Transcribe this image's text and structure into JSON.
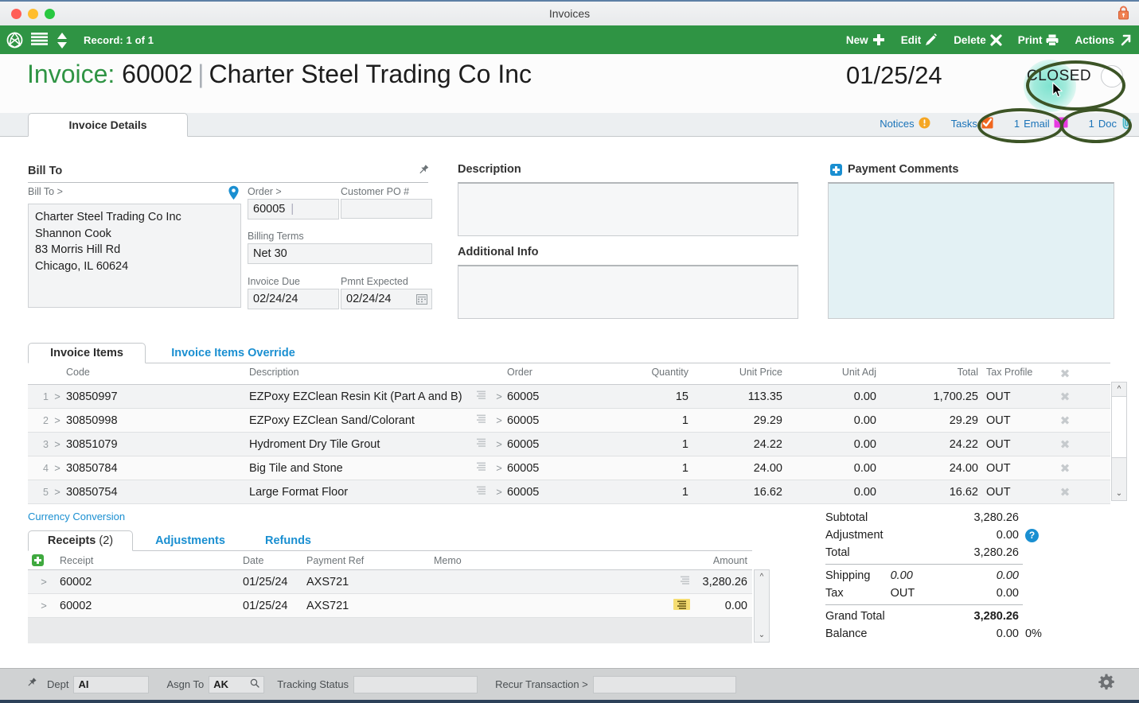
{
  "window": {
    "title": "Invoices",
    "lock_icon": "lock-icon"
  },
  "toolbar": {
    "record_label": "Record: 1 of 1",
    "globe_icon": "globe-icon",
    "list_icon": "list-icon",
    "updown_icon": "up-down-arrows-icon",
    "actions": [
      {
        "label": "New",
        "icon": "plus-icon"
      },
      {
        "label": "Edit",
        "icon": "pencil-icon"
      },
      {
        "label": "Delete",
        "icon": "x-cross-icon"
      },
      {
        "label": "Print",
        "icon": "printer-icon"
      },
      {
        "label": "Actions",
        "icon": "arrow-up-right-icon"
      }
    ]
  },
  "header": {
    "entity_word": "Invoice:",
    "separator": "|",
    "record_number": "60002",
    "customer_name": "Charter Steel Trading Co Inc",
    "date": "01/25/24",
    "status": "CLOSED"
  },
  "tabs": {
    "main": "Invoice Details"
  },
  "header_links": [
    {
      "label": "Notices",
      "icon": "warning-icon"
    },
    {
      "label": "Tasks",
      "icon": "checkbox-checked-icon"
    },
    {
      "count": "1",
      "label": "Email",
      "icon": "envelope-icon"
    },
    {
      "count": "1",
      "label": "Doc",
      "icon": "paperclip-icon"
    }
  ],
  "billto": {
    "title": "Bill To",
    "pin_icon": "pushpin-icon",
    "field_label": "Bill To >",
    "location_icon": "map-pin-icon",
    "address_lines": "Charter Steel Trading Co Inc\nShannon Cook\n83 Morris Hill Rd\nChicago, IL 60624",
    "order_label": "Order >",
    "order_value": "60005",
    "customer_po_label": "Customer PO #",
    "customer_po_value": "",
    "billing_terms_label": "Billing Terms",
    "billing_terms_value": "Net 30",
    "invoice_due_label": "Invoice Due",
    "invoice_due_value": "02/24/24",
    "pmnt_expected_label": "Pmnt Expected",
    "pmnt_expected_value": "02/24/24",
    "calendar_icon": "calendar-icon"
  },
  "description": {
    "title": "Description",
    "value": ""
  },
  "additional_info": {
    "title": "Additional Info",
    "value": ""
  },
  "payment_comments": {
    "title": "Payment Comments",
    "value": "",
    "add_icon": "plus-square-icon"
  },
  "items": {
    "tabs": [
      {
        "label": "Invoice Items",
        "active": true
      },
      {
        "label": "Invoice Items Override",
        "active": false
      }
    ],
    "columns": [
      "Code",
      "Description",
      "Order",
      "Quantity",
      "Unit Price",
      "Unit Adj",
      "Total",
      "Tax Profile"
    ],
    "rows": [
      {
        "idx": "1",
        "code": "30850997",
        "description": "EZPoxy EZClean Resin Kit (Part A and B)",
        "order": "60005",
        "quantity": "15",
        "unit_price": "113.35",
        "unit_adj": "0.00",
        "total": "1,700.25",
        "tax_profile": "OUT"
      },
      {
        "idx": "2",
        "code": "30850998",
        "description": "EZPoxy EZClean Sand/Colorant",
        "order": "60005",
        "quantity": "1",
        "unit_price": "29.29",
        "unit_adj": "0.00",
        "total": "29.29",
        "tax_profile": "OUT"
      },
      {
        "idx": "3",
        "code": "30851079",
        "description": "Hydroment Dry Tile Grout",
        "order": "60005",
        "quantity": "1",
        "unit_price": "24.22",
        "unit_adj": "0.00",
        "total": "24.22",
        "tax_profile": "OUT"
      },
      {
        "idx": "4",
        "code": "30850784",
        "description": "Big Tile and Stone",
        "order": "60005",
        "quantity": "1",
        "unit_price": "24.00",
        "unit_adj": "0.00",
        "total": "24.00",
        "tax_profile": "OUT"
      },
      {
        "idx": "5",
        "code": "30850754",
        "description": "Large Format Floor",
        "order": "60005",
        "quantity": "1",
        "unit_price": "16.62",
        "unit_adj": "0.00",
        "total": "16.62",
        "tax_profile": "OUT"
      }
    ]
  },
  "currency_conversion_link": "Currency Conversion",
  "receipts": {
    "tabs": [
      {
        "label": "Receipts",
        "count": "(2)",
        "active": true
      },
      {
        "label": "Adjustments",
        "count": "",
        "active": false
      },
      {
        "label": "Refunds",
        "count": "",
        "active": false
      }
    ],
    "columns": [
      "Receipt",
      "Date",
      "Payment Ref",
      "Memo",
      "Amount"
    ],
    "rows": [
      {
        "receipt": "60002",
        "date": "01/25/24",
        "payment_ref": "AXS721",
        "memo": "",
        "amount": "3,280.26",
        "memo_highlighted": false
      },
      {
        "receipt": "60002",
        "date": "01/25/24",
        "payment_ref": "AXS721",
        "memo": "",
        "amount": "0.00",
        "memo_highlighted": true
      }
    ]
  },
  "totals": {
    "subtotal_label": "Subtotal",
    "subtotal_value": "3,280.26",
    "adjustment_label": "Adjustment",
    "adjustment_value": "0.00",
    "adjustment_help_icon": "help-circle-icon",
    "total_label": "Total",
    "total_value": "3,280.26",
    "shipping_label": "Shipping",
    "shipping_mid": "0.00",
    "shipping_value": "0.00",
    "tax_label": "Tax",
    "tax_mid": "OUT",
    "tax_value": "0.00",
    "grand_total_label": "Grand Total",
    "grand_total_value": "3,280.26",
    "balance_label": "Balance",
    "balance_value": "0.00",
    "balance_pct": "0%"
  },
  "statusbar": {
    "pin_icon": "pushpin-icon",
    "dept_label": "Dept",
    "dept_value": "AI",
    "asgn_label": "Asgn To",
    "asgn_value": "AK",
    "asgn_search_icon": "magnifier-icon",
    "tracking_label": "Tracking Status",
    "tracking_value": "",
    "recur_label": "Recur Transaction >",
    "recur_value": "",
    "gear_icon": "gear-icon"
  },
  "colors": {
    "toolbar_green": "#2f9444",
    "link_blue": "#1a8fd1",
    "highlight_oval": "#3c5426",
    "glow_teal": "#78e1cd",
    "memo_highlight": "#f5dd72"
  }
}
